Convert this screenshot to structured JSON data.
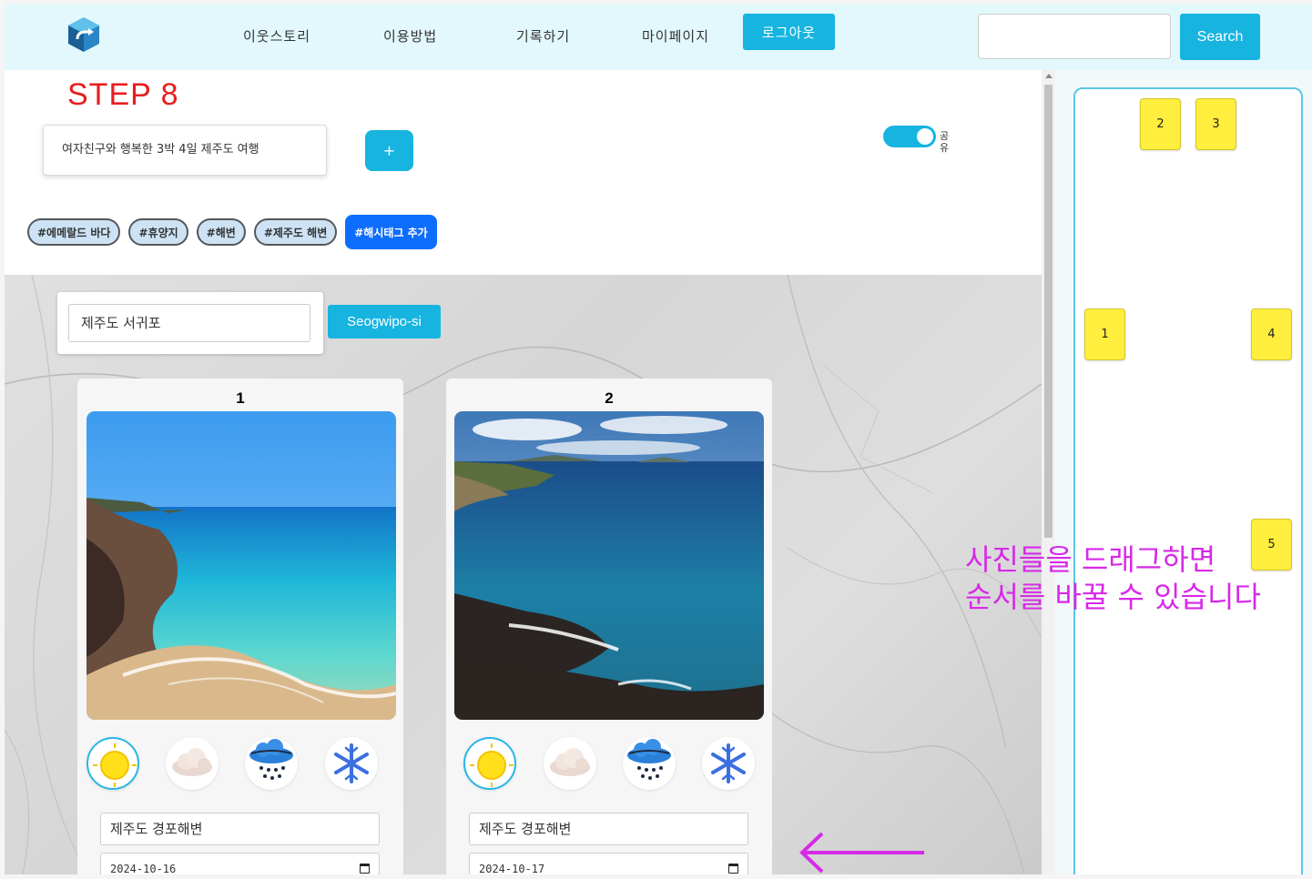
{
  "navbar": {
    "links": [
      "이웃스토리",
      "이용방법",
      "기록하기",
      "마이페이지"
    ],
    "logout_label": "로그아웃",
    "search_placeholder": "",
    "search_label": "Search"
  },
  "header": {
    "step_title": "STEP 8",
    "trip_title": "여자친구와 행복한 3박 4일 제주도 여행",
    "add_label": "+",
    "share_label": "공유",
    "share_enabled": true
  },
  "tags": [
    "#에메랄드 바다",
    "#휴양지",
    "#해변",
    "#제주도 해변"
  ],
  "tag_add_label": "#해시태그 추가",
  "location": {
    "query": "제주도 서귀포",
    "result_label": "Seogwipo-si"
  },
  "cards": [
    {
      "number": "1",
      "place": "제주도 경포해변",
      "date": "2024-10-16",
      "selected_weather": "sunny"
    },
    {
      "number": "2",
      "place": "제주도 경포해변",
      "date": "2024-10-17",
      "selected_weather": "sunny"
    }
  ],
  "weather_icons": [
    "sun-icon",
    "cloud-icon",
    "rain-icon",
    "snowflake-icon"
  ],
  "annotation": {
    "line1": "사진들을 드래그하면",
    "line2": "순서를 바꿀 수 있습니다"
  },
  "side_notes": [
    "2",
    "3",
    "1",
    "4",
    "5"
  ],
  "colors": {
    "accent": "#17b4e0",
    "nav_bg": "#e2f8fc",
    "step_red": "#e81d1d",
    "annotation_magenta": "#d729e8",
    "note_yellow": "#ffee3d",
    "tag_add_blue": "#0d6efd"
  }
}
